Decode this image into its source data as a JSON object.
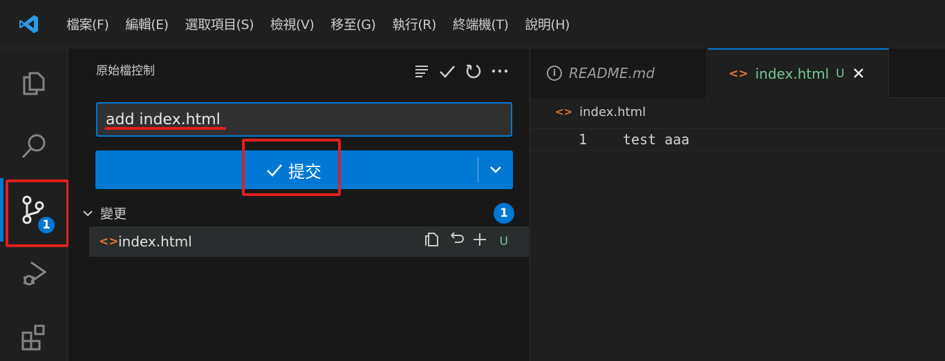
{
  "menubar": {
    "items": [
      "檔案(F)",
      "編輯(E)",
      "選取項目(S)",
      "檢視(V)",
      "移至(G)",
      "執行(R)",
      "終端機(T)",
      "說明(H)"
    ]
  },
  "activitybar": {
    "items": [
      "explorer-icon",
      "search-icon",
      "source-control-icon",
      "run-debug-icon",
      "extensions-icon"
    ],
    "source_control_badge": "1"
  },
  "sidebar": {
    "title": "原始檔控制",
    "commit_message": "add index.html",
    "commit_button_label": "提交",
    "changes_label": "變更",
    "changes_count": "1",
    "files": [
      {
        "name": "index.html",
        "status": "U"
      }
    ]
  },
  "editor": {
    "tabs": [
      {
        "label": "README.md",
        "active": false
      },
      {
        "label": "index.html",
        "status": "U",
        "active": true
      }
    ],
    "breadcrumb": "index.html",
    "lines": [
      {
        "number": "1",
        "text": "test aaa"
      }
    ]
  },
  "colors": {
    "accent": "#0078d4",
    "highlight": "#e02020",
    "untracked": "#73c991",
    "html_icon": "#e37933"
  }
}
